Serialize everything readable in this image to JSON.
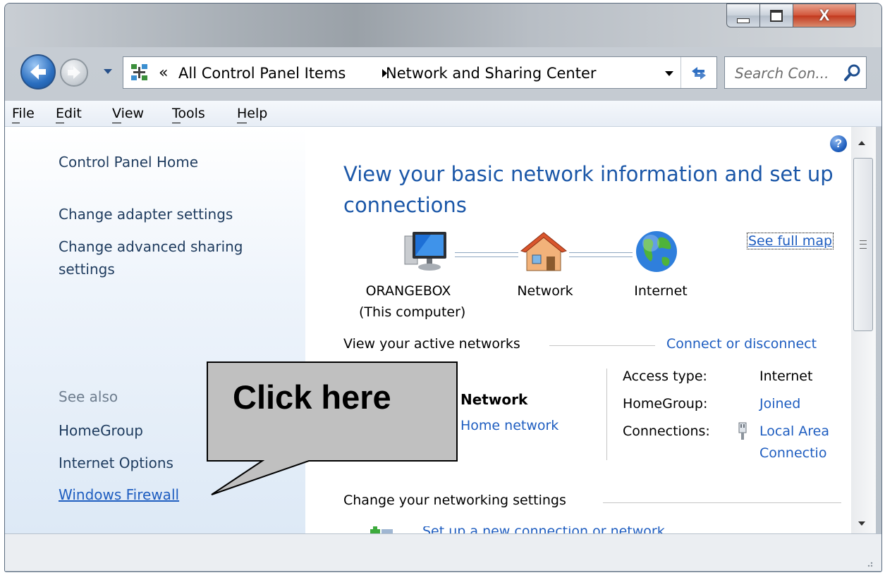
{
  "window": {
    "minimize_glyph": "_",
    "maximize_glyph": "☐",
    "close_glyph": "X"
  },
  "address_bar": {
    "chevron": "«",
    "crumb_1": "All Control Panel Items",
    "crumb_2": "Network and Sharing Center"
  },
  "search": {
    "placeholder": "Search Con..."
  },
  "menu": {
    "file": "File",
    "edit": "Edit",
    "view": "View",
    "tools": "Tools",
    "help": "Help"
  },
  "sidebar": {
    "home": "Control Panel Home",
    "adapter": "Change adapter settings",
    "advanced_line1": "Change advanced sharing",
    "advanced_line2": "settings",
    "see_also": "See also",
    "homegroup": "HomeGroup",
    "internet_options": "Internet Options",
    "windows_firewall": "Windows Firewall"
  },
  "main": {
    "help_glyph": "?",
    "heading_line1": "View your basic network information and set up",
    "heading_line2": "connections",
    "see_full_map": "See full map",
    "map": {
      "computer_name": "ORANGEBOX",
      "computer_sub": "(This computer)",
      "network": "Network",
      "internet": "Internet"
    },
    "active_networks_label": "View your active networks",
    "connect_disconnect": "Connect or disconnect",
    "network_name": "Network",
    "network_type": "Home network",
    "access_type_label": "Access type:",
    "access_type_value": "Internet",
    "homegroup_label": "HomeGroup:",
    "homegroup_value": "Joined",
    "connections_label": "Connections:",
    "connections_value_line1": "Local Area",
    "connections_value_line2": "Connectio",
    "change_settings_label": "Change your networking settings",
    "partial_item": "Set up a new connection or network"
  },
  "callout": {
    "text": "Click here"
  },
  "colors": {
    "link": "#1e5dc0",
    "heading": "#1b57a8",
    "callout_fill": "#c0c0c0"
  }
}
